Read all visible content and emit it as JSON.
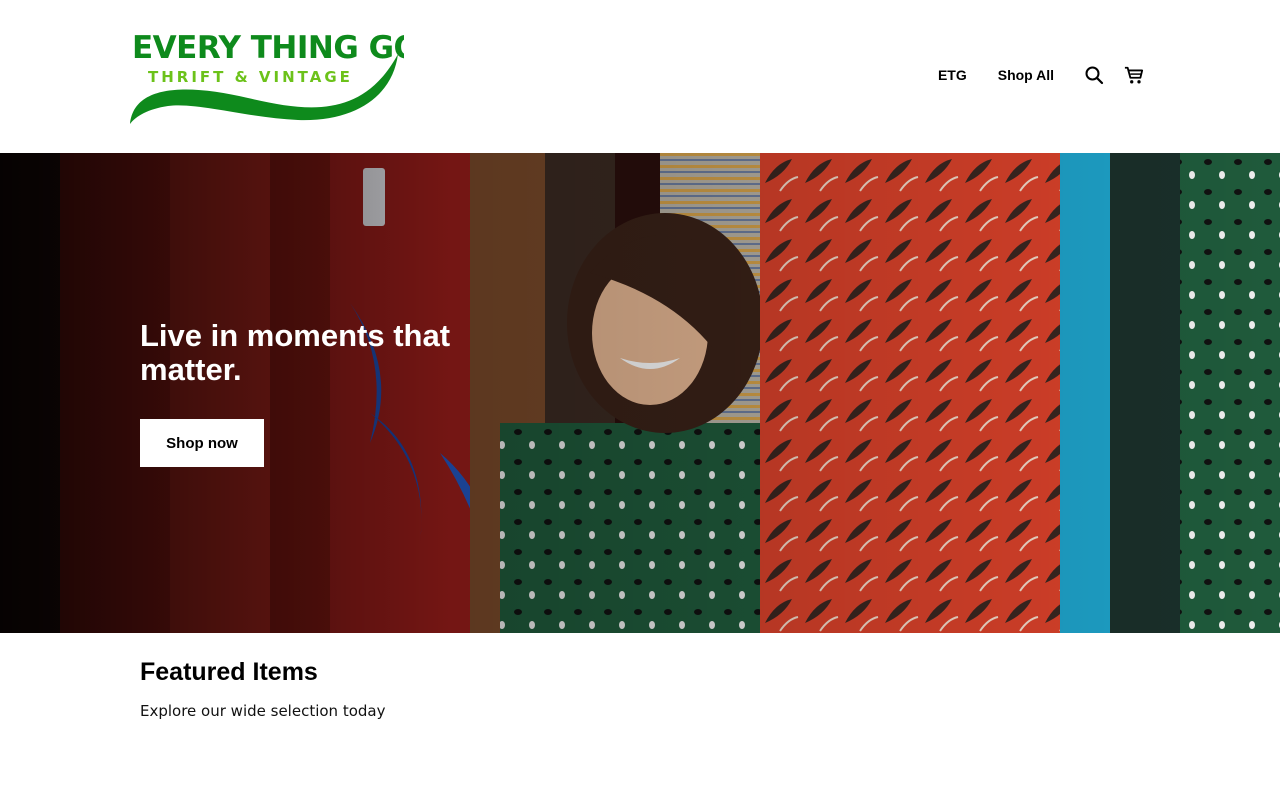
{
  "brand": {
    "logo_line1": "EVERY THING GOES",
    "logo_line2": "THRIFT & VINTAGE",
    "logo_colors": {
      "primary": "#0e8a1c",
      "secondary": "#6cc21a"
    }
  },
  "nav": {
    "items": [
      {
        "label": "ETG"
      },
      {
        "label": "Shop All"
      }
    ],
    "search_icon": "search-icon",
    "cart_icon": "cart-icon"
  },
  "hero": {
    "title": "Live in moments that matter.",
    "button_label": "Shop now"
  },
  "featured": {
    "title": "Featured Items",
    "subtitle": "Explore our wide selection today"
  }
}
